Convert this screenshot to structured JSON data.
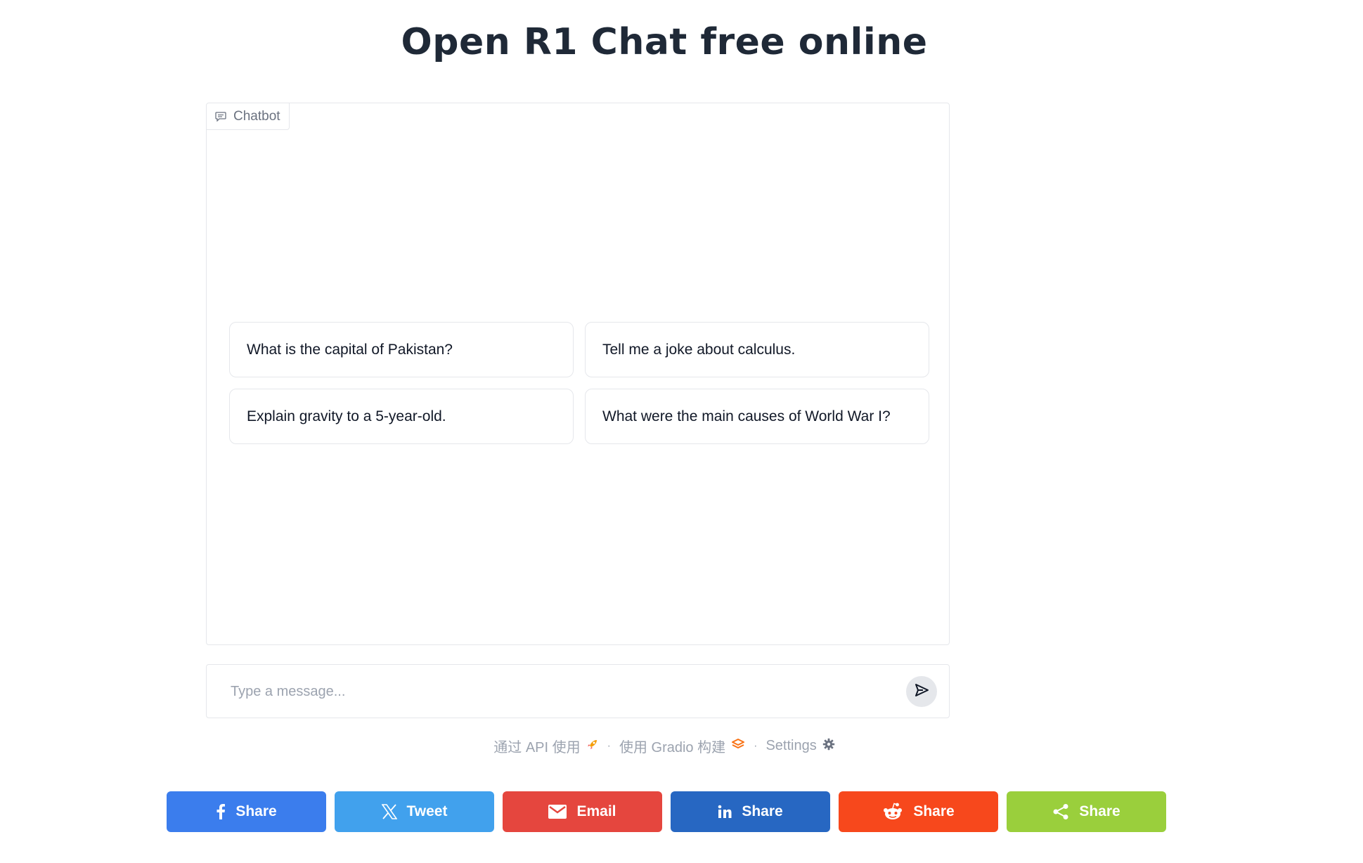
{
  "page": {
    "title": "Open R1 Chat free online"
  },
  "chatbot": {
    "label": "Chatbot",
    "examples": [
      "What is the capital of Pakistan?",
      "Tell me a joke about calculus.",
      "Explain gravity to a 5-year-old.",
      "What were the main causes of World War I?"
    ]
  },
  "input": {
    "placeholder": "Type a message..."
  },
  "footer": {
    "api_link": "通过 API 使用",
    "built_with": "使用 Gradio 构建",
    "settings": "Settings",
    "separator": "·"
  },
  "share": {
    "buttons": [
      {
        "label": "Share",
        "icon": "facebook-icon",
        "color": "#3b7ded"
      },
      {
        "label": "Tweet",
        "icon": "x-icon",
        "color": "#41a1ed"
      },
      {
        "label": "Email",
        "icon": "email-icon",
        "color": "#e5463e"
      },
      {
        "label": "Share",
        "icon": "linkedin-icon",
        "color": "#2767c2"
      },
      {
        "label": "Share",
        "icon": "reddit-icon",
        "color": "#f7481c"
      },
      {
        "label": "Share",
        "icon": "share-icon",
        "color": "#9acf3c"
      }
    ]
  }
}
